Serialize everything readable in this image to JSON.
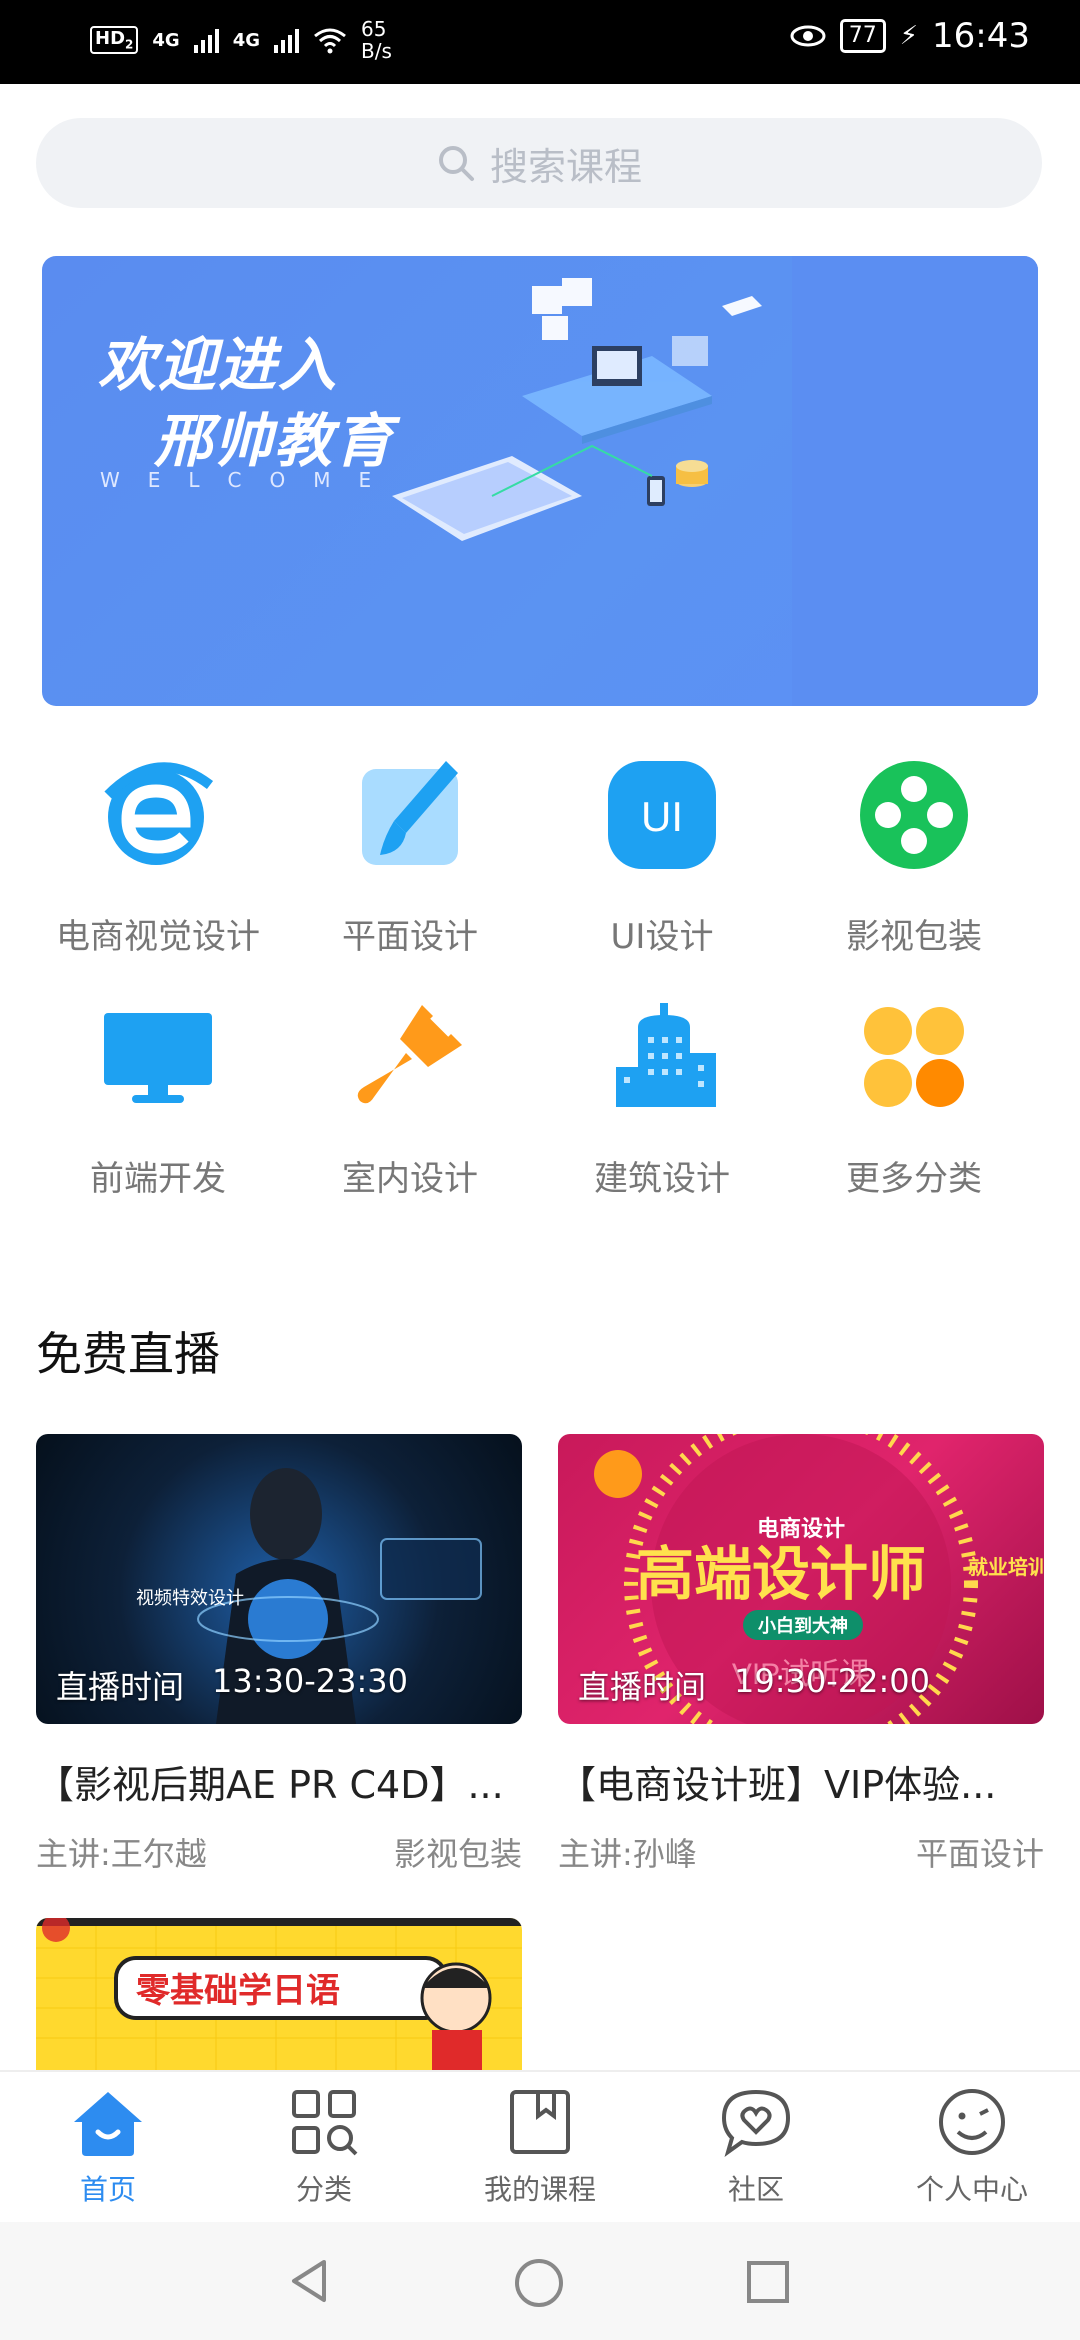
{
  "status_bar": {
    "hd": "HD",
    "hd_sub": "2",
    "net1": "4G",
    "net2": "4G",
    "speed_value": "65",
    "speed_unit": "B/s",
    "battery": "77",
    "time": "16:43"
  },
  "search": {
    "placeholder": "搜索课程"
  },
  "banner": {
    "line1": "欢迎进入",
    "line2": "邢帅教育",
    "line3": "WELCOME"
  },
  "categories": [
    {
      "label": "电商视觉设计",
      "icon": "e-icon",
      "color": "#1ea1f2"
    },
    {
      "label": "平面设计",
      "icon": "brush-icon",
      "color": "#1ea1f2"
    },
    {
      "label": "UI设计",
      "icon": "ui-icon",
      "color": "#1ea1f2"
    },
    {
      "label": "影视包装",
      "icon": "film-reel-icon",
      "color": "#19c25a"
    },
    {
      "label": "前端开发",
      "icon": "monitor-icon",
      "color": "#1ea1f2"
    },
    {
      "label": "室内设计",
      "icon": "paint-roller-icon",
      "color": "#ff9a1a"
    },
    {
      "label": "建筑设计",
      "icon": "building-icon",
      "color": "#1ea1f2"
    },
    {
      "label": "更多分类",
      "icon": "more-dots-icon",
      "color": "#ffc23a"
    }
  ],
  "live_section": {
    "title": "免费直播",
    "cards": [
      {
        "time_label": "直播时间",
        "time": "13:30-23:30",
        "title": "【影视后期AE PR C4D】...",
        "teacher": "主讲:王尔越",
        "category": "影视包装",
        "image_text": "视频特效设计"
      },
      {
        "time_label": "直播时间",
        "time": "19:30-22:00",
        "title": "【电商设计班】VIP体验...",
        "teacher": "主讲:孙峰",
        "category": "平面设计",
        "image_top": "电商设计",
        "image_main": "高端设计师",
        "image_side": "就业培训",
        "image_pill": "小白到大神",
        "image_bottom": "VIP试听课"
      }
    ],
    "third_card_text": "零基础学日语"
  },
  "tabs": [
    {
      "label": "首页",
      "icon": "home-icon",
      "active": true
    },
    {
      "label": "分类",
      "icon": "category-icon",
      "active": false
    },
    {
      "label": "我的课程",
      "icon": "bookmark-icon",
      "active": false
    },
    {
      "label": "社区",
      "icon": "community-heart-icon",
      "active": false
    },
    {
      "label": "个人中心",
      "icon": "profile-face-icon",
      "active": false
    }
  ],
  "colors": {
    "accent": "#2d8cf0",
    "banner": "#5a8cf0"
  }
}
